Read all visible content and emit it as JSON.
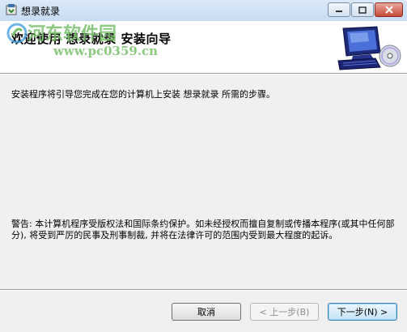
{
  "window": {
    "title": "想录就录"
  },
  "header": {
    "title": "欢迎使用 想录就录 安装向导",
    "watermark_text": "河东软件园",
    "watermark_url": "www.pc0359.cn"
  },
  "body": {
    "intro": "安装程序将引导您完成在您的计算机上安装 想录就录 所需的步骤。",
    "warning": "警告: 本计算机程序受版权法和国际条约保护。如未经授权而擅自复制或传播本程序(或其中任何部分), 将受到严厉的民事及刑事制裁, 并将在法律许可的范围内受到最大程度的起诉。"
  },
  "buttons": {
    "cancel": "取消",
    "back": "< 上一步(B)",
    "next": "下一步(N) >"
  },
  "colors": {
    "titlebar": "#c6dbf2",
    "panel": "#f0f0f0",
    "watermark": "#79c06a"
  }
}
